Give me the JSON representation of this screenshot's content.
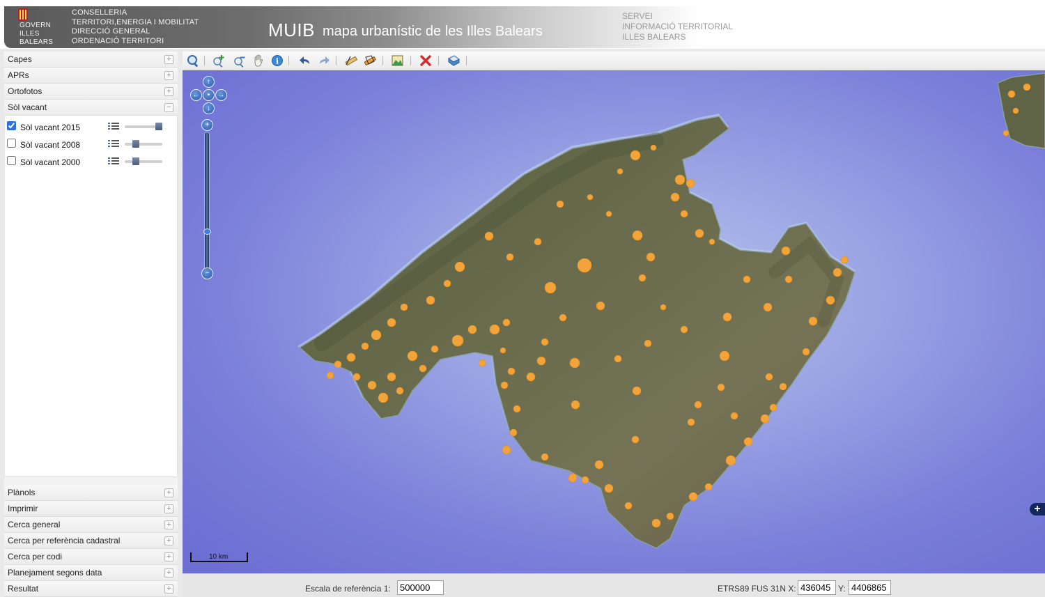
{
  "header": {
    "govern_lines": [
      "GOVERN",
      "ILLES",
      "BALEARS"
    ],
    "conselleria_lines": [
      "CONSELLERIA",
      "TERRITORI,ENERGIA I MOBILITAT",
      "DIRECCIÓ GENERAL",
      "ORDENACIÓ TERRITORI"
    ],
    "title": "MUIB",
    "subtitle": "mapa urbanístic de les Illes Balears",
    "servei_lines": [
      "SERVEI",
      "INFORMACIÓ TERRITORIAL",
      "ILLES BALEARS"
    ]
  },
  "sidebar": {
    "top_sections": [
      {
        "label": "Capes",
        "toggle": "+"
      },
      {
        "label": "APRs",
        "toggle": "+"
      },
      {
        "label": "Ortofotos",
        "toggle": "+"
      },
      {
        "label": "Sòl vacant",
        "toggle": "−"
      }
    ],
    "layers": [
      {
        "label": "Sòl vacant 2015",
        "checked": true,
        "opacity": 1.0
      },
      {
        "label": "Sòl vacant 2008",
        "checked": false,
        "opacity": 0.25
      },
      {
        "label": "Sòl vacant 2000",
        "checked": false,
        "opacity": 0.25
      }
    ],
    "bottom_sections": [
      {
        "label": "Plànols",
        "toggle": "+"
      },
      {
        "label": "Imprimir",
        "toggle": "+"
      },
      {
        "label": "Cerca general",
        "toggle": "+"
      },
      {
        "label": "Cerca per referència cadastral",
        "toggle": "+"
      },
      {
        "label": "Cerca per codi",
        "toggle": "+"
      },
      {
        "label": "Planejament segons data",
        "toggle": "+"
      },
      {
        "label": "Resultat",
        "toggle": "+"
      }
    ]
  },
  "toolbar": {
    "tools": [
      "zoom-extent-icon",
      "zoom-in-icon",
      "zoom-out-icon",
      "pan-hand-icon",
      "info-icon",
      "undo-icon",
      "redo-icon",
      "measure-distance-icon",
      "measure-area-icon",
      "map-export-icon",
      "clear-icon",
      "print-icon"
    ]
  },
  "map": {
    "zoom_level": 0.3,
    "scale_label": "10 km",
    "colors": {
      "sea": "#6f74d4",
      "land": "#5f6648",
      "vacant_land": "#f2a43a"
    }
  },
  "status": {
    "scale_label": "Escala de referència 1:",
    "scale_value": "500000",
    "coord_label_x": "ETRS89 FUS 31N X:",
    "x_value": "436045",
    "coord_label_y": "Y:",
    "y_value": "4406865"
  }
}
